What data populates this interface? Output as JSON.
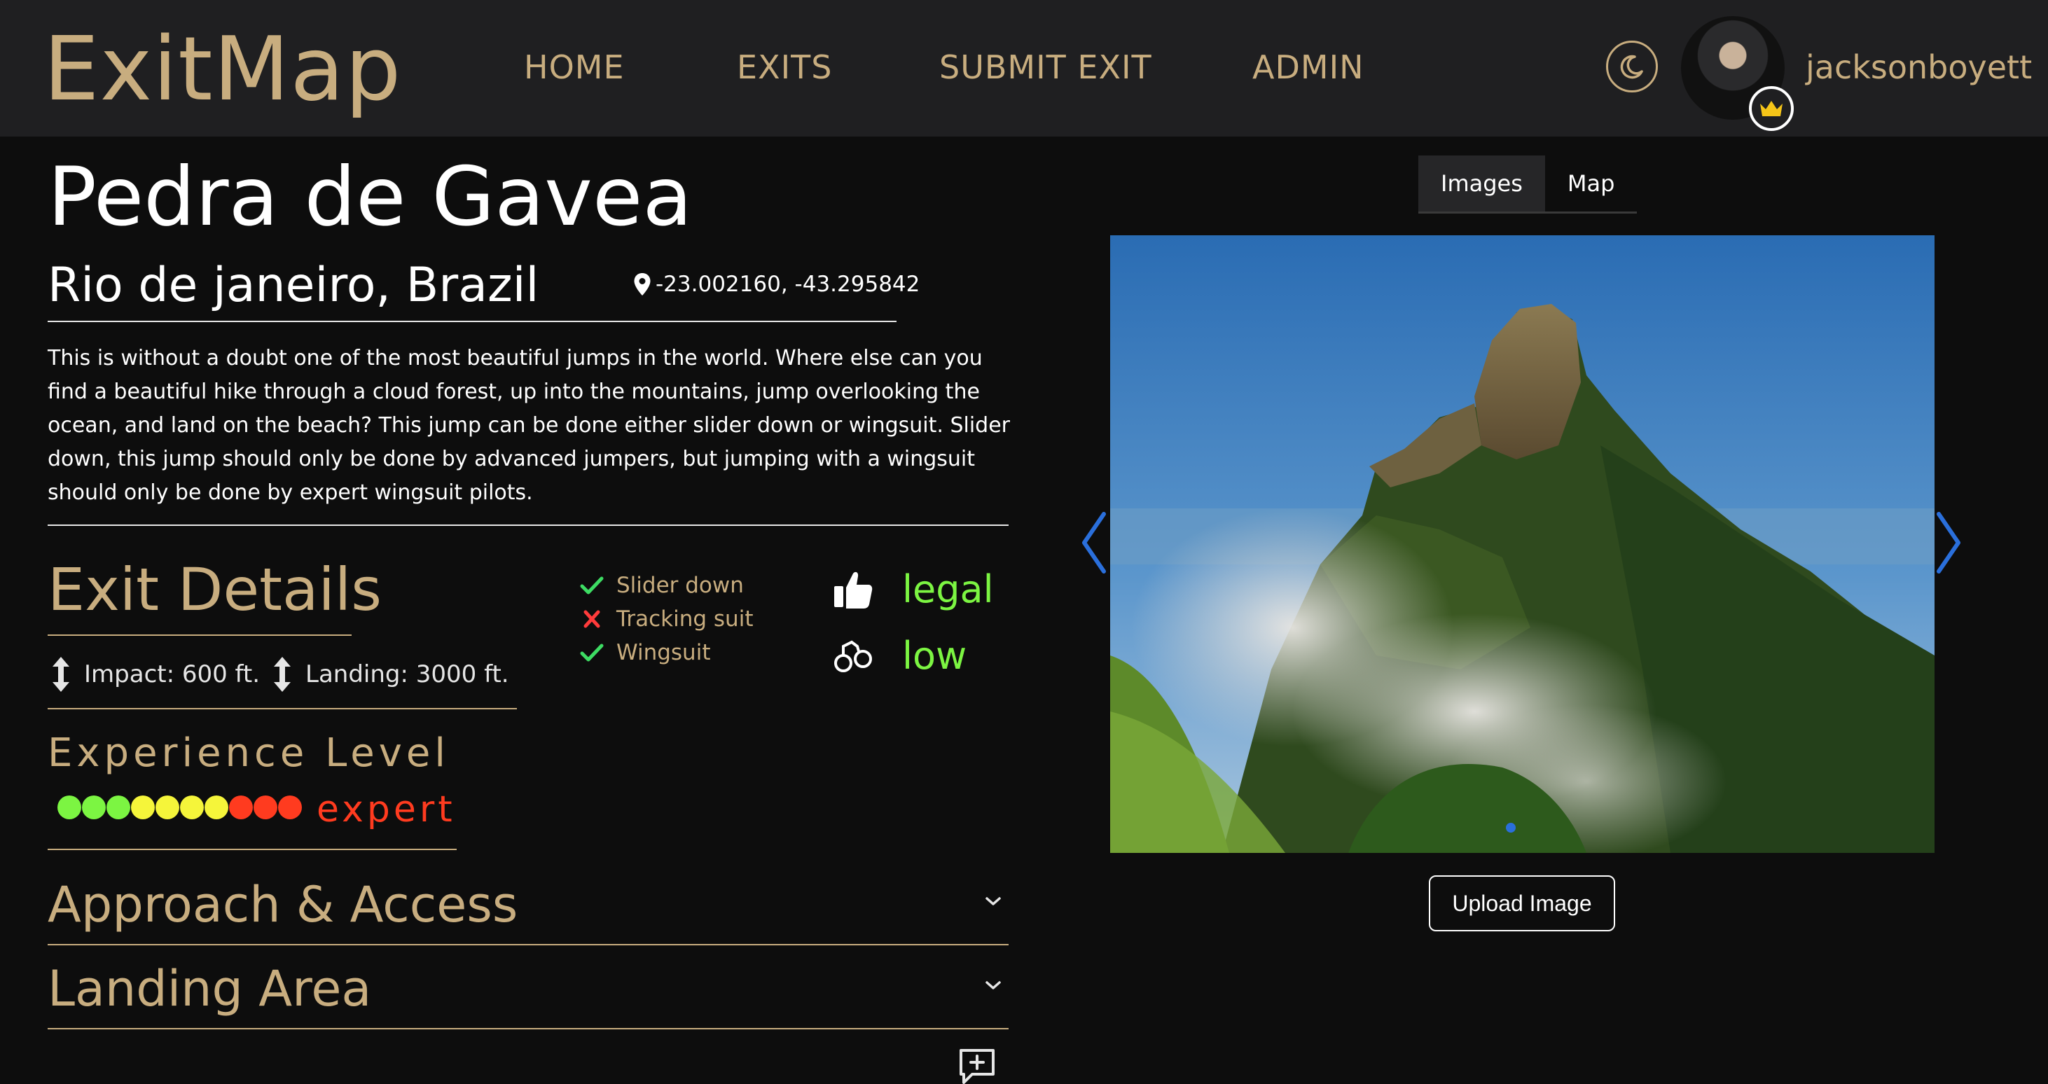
{
  "nav": {
    "brand": "ExitMap",
    "links": [
      "HOME",
      "EXITS",
      "SUBMIT EXIT",
      "ADMIN"
    ],
    "username": "jacksonboyett",
    "theme_icon": "moon-icon",
    "badge_icon": "crown-icon"
  },
  "exit": {
    "name": "Pedra de Gavea",
    "location": "Rio de janeiro, Brazil",
    "coordinates": "-23.002160, -43.295842",
    "description": "This is without a doubt one of the most beautiful jumps in the world. Where else can you find a beautiful hike through a cloud forest, up into the mountains, jump overlooking the ocean, and land on the beach? This jump can be done either slider down or wingsuit. Slider down, this jump should only be done by advanced jumpers, but jumping with a wingsuit should only be done by expert wingsuit pilots."
  },
  "details": {
    "heading": "Exit Details",
    "impact": "Impact: 600 ft.",
    "landing": "Landing: 3000 ft.",
    "jump_types": [
      {
        "label": "Slider down",
        "allowed": true
      },
      {
        "label": "Tracking suit",
        "allowed": false
      },
      {
        "label": "Wingsuit",
        "allowed": true
      }
    ],
    "legality": "legal",
    "bust_risk": "low",
    "experience_heading": "Experience Level",
    "experience_label": "expert",
    "experience_level": 10,
    "experience_max": 10
  },
  "sections": {
    "approach": "Approach & Access",
    "landing_area": "Landing Area"
  },
  "media": {
    "tabs": [
      "Images",
      "Map"
    ],
    "active_tab": "Images",
    "upload_label": "Upload Image",
    "carousel_index": 1
  },
  "colors": {
    "gold": "#c8ad7f",
    "legal_green": "#7cf542",
    "expert_red": "#ff3b1f",
    "carousel_blue": "#2a6fdb"
  }
}
